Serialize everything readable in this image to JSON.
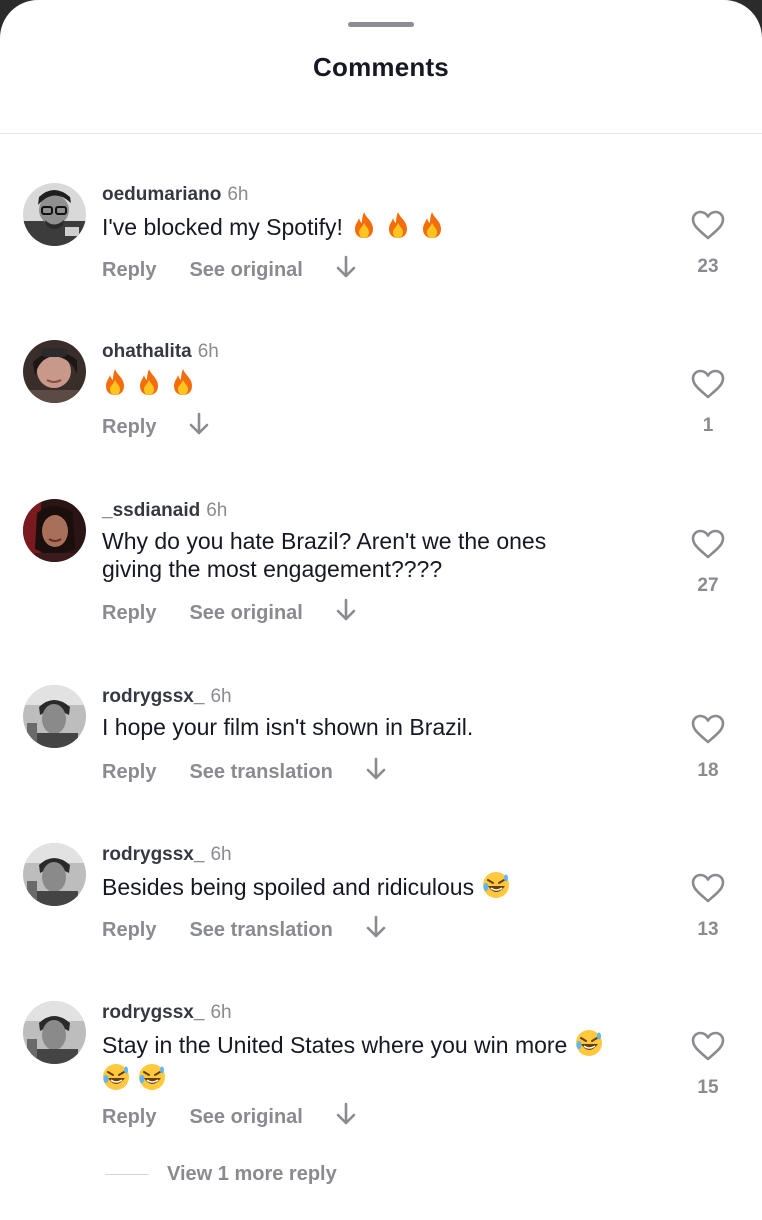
{
  "sheet": {
    "title": "Comments"
  },
  "actions": {
    "reply_label": "Reply",
    "see_original_label": "See original",
    "see_translation_label": "See translation"
  },
  "comments": [
    {
      "username": "oedumariano",
      "time": "6h",
      "text": "I've blocked my Spotify!",
      "emojis": [
        "fire",
        "fire",
        "fire"
      ],
      "likes": "23",
      "secondary_action": "See original"
    },
    {
      "username": "ohathalita",
      "time": "6h",
      "text": "",
      "emojis": [
        "fire",
        "fire",
        "fire"
      ],
      "likes": "1",
      "secondary_action": ""
    },
    {
      "username": "_ssdianaid",
      "time": "6h",
      "text": "Why do you hate Brazil? Aren't we the ones giving the most engagement????",
      "emojis": [],
      "likes": "27",
      "secondary_action": "See original"
    },
    {
      "username": "rodrygssx_",
      "time": "6h",
      "text": "I hope your film isn't shown in Brazil.",
      "emojis": [],
      "likes": "18",
      "secondary_action": "See translation"
    },
    {
      "username": "rodrygssx_",
      "time": "6h",
      "text": "Besides being spoiled and ridiculous",
      "emojis": [
        "rofl"
      ],
      "likes": "13",
      "secondary_action": "See translation"
    },
    {
      "username": "rodrygssx_",
      "time": "6h",
      "text": "Stay in the United States where you win more",
      "emojis": [
        "rofl",
        "rofl",
        "rofl"
      ],
      "likes": "15",
      "secondary_action": "See original"
    }
  ],
  "view_more": {
    "label": "View 1 more reply"
  },
  "icons": {
    "like": "heart-outline-icon",
    "translate_arrow": "arrow-down-icon",
    "fire": "fire-emoji",
    "rofl": "rolling-laughing-emoji"
  },
  "colors": {
    "text_primary": "#161823",
    "text_secondary": "#8a8b91",
    "background": "#ffffff"
  }
}
